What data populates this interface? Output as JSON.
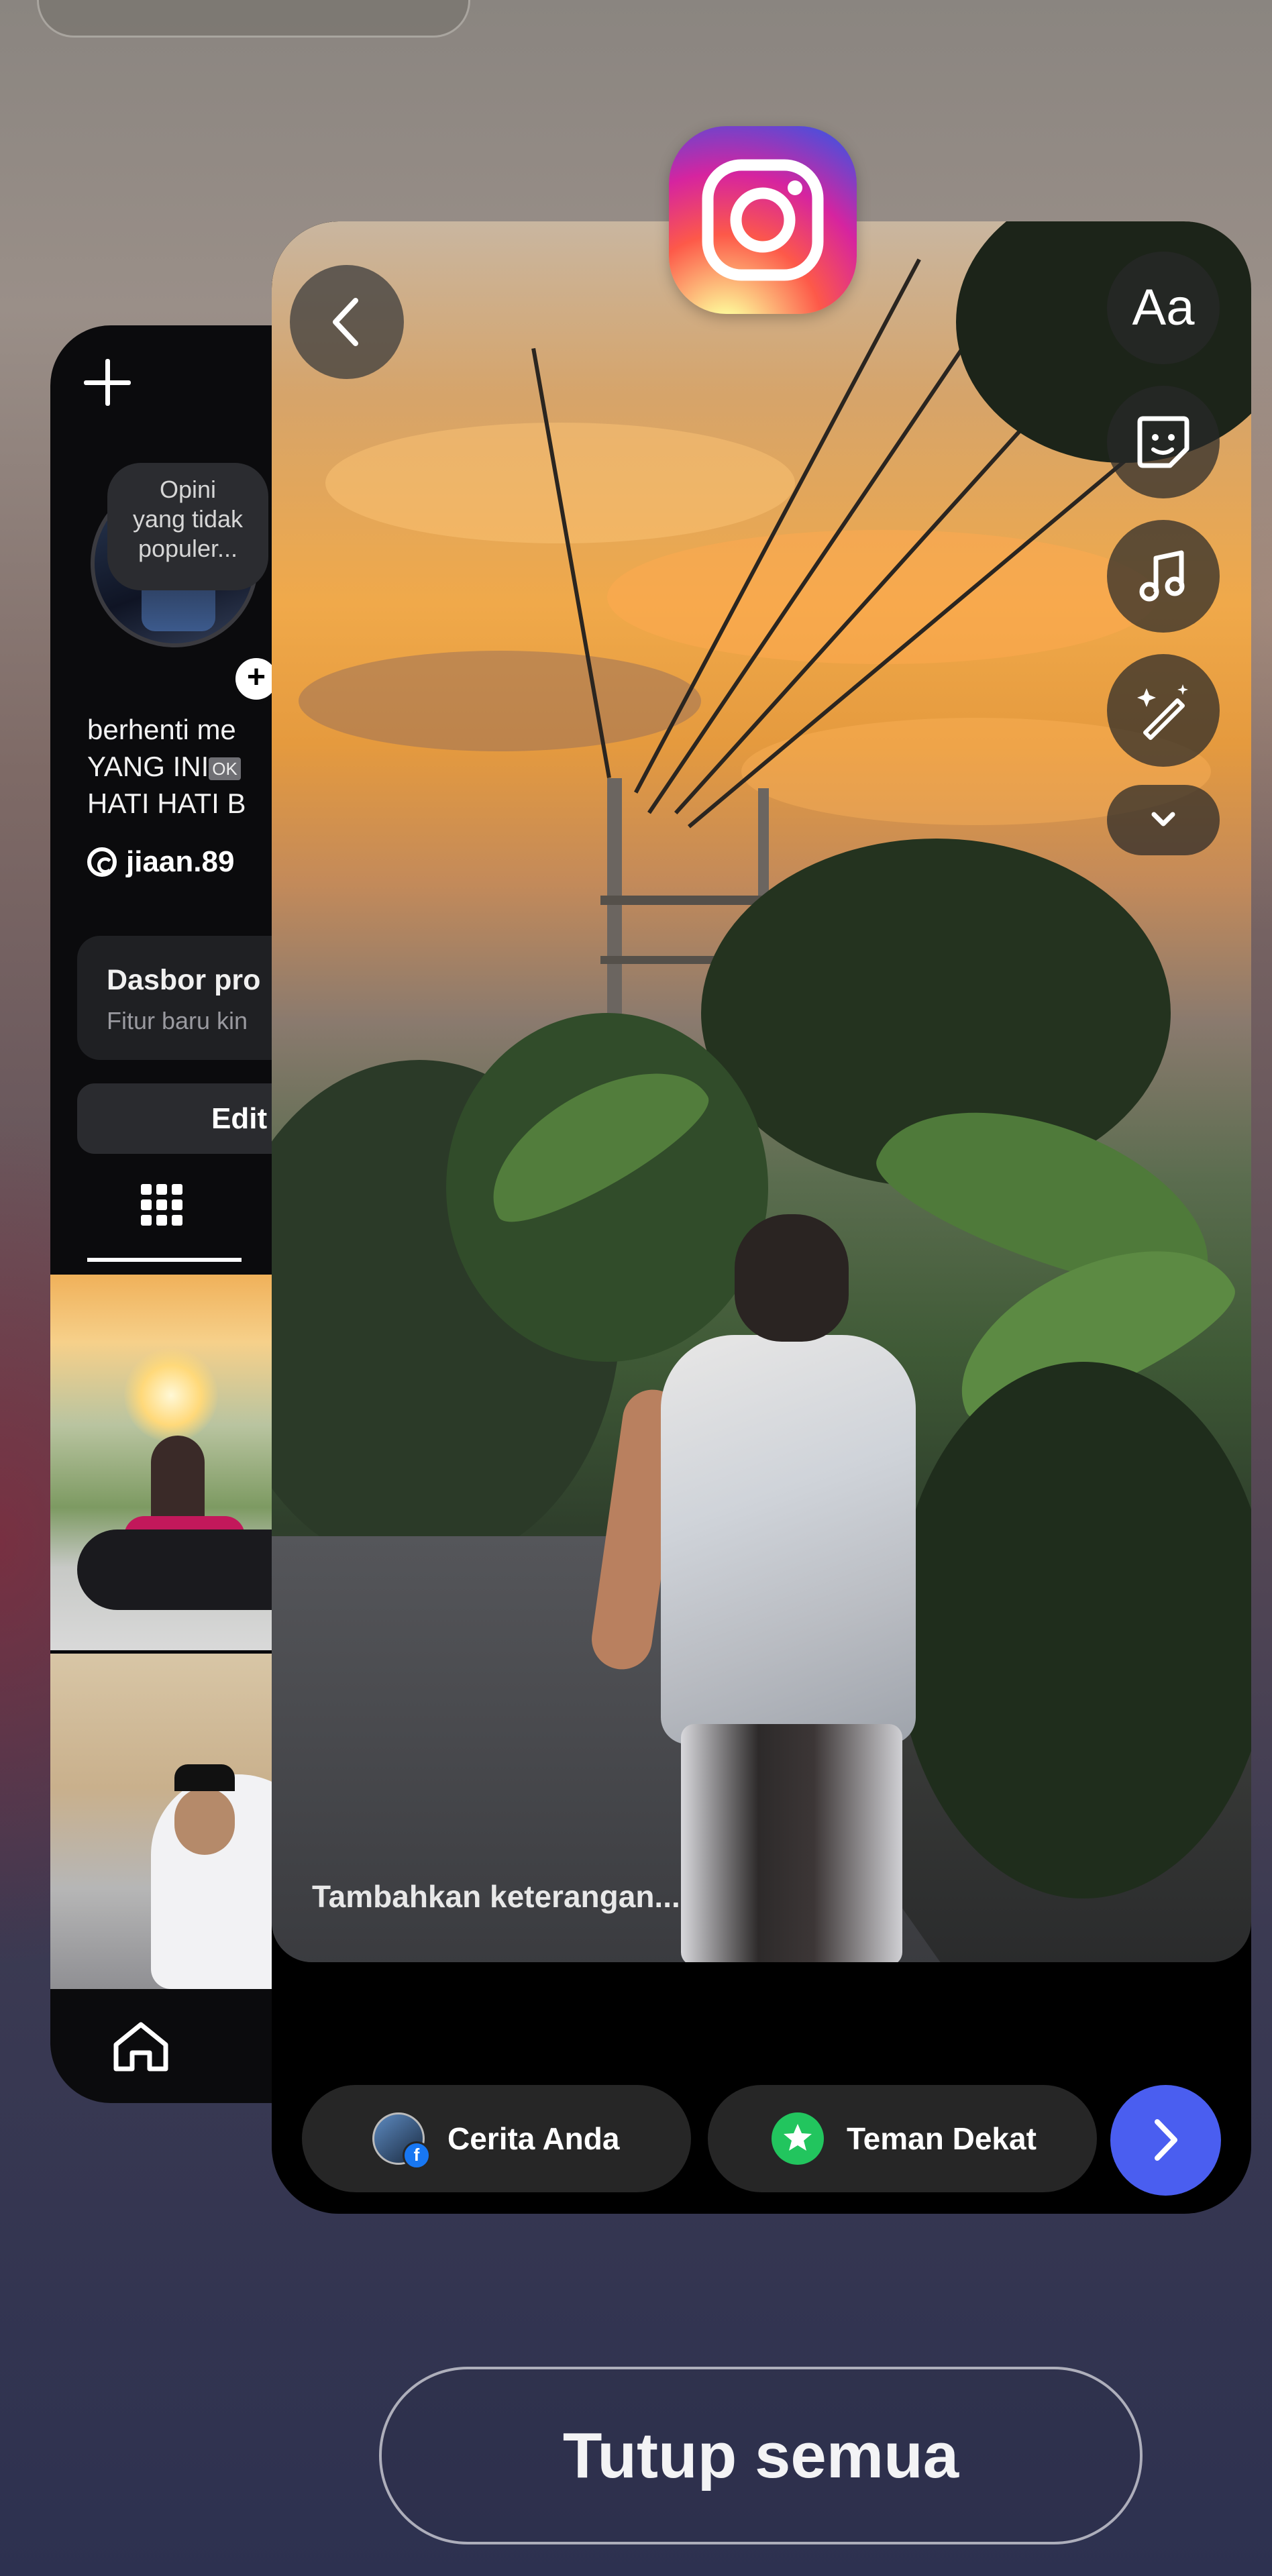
{
  "left_card": {
    "note": "Opini\nyang tidak\npopuler...",
    "bio_line1": "berhenti me",
    "bio_line2": "YANG INI",
    "bio_ok": "OK",
    "bio_line3": "HATI HATI B",
    "handle": "jiaan.89",
    "dashboard_title": "Dasbor pro",
    "dashboard_sub": "Fitur baru kin",
    "edit_label": "Edit",
    "icons": [
      "plus-icon",
      "add-story-icon",
      "threads-icon",
      "grid-icon",
      "home-icon"
    ]
  },
  "story_editor": {
    "caption_placeholder": "Tambahkan keterangan...",
    "tools": {
      "text_label": "Aa",
      "icons": [
        "back-arrow-icon",
        "sticker-icon",
        "music-icon",
        "effects-wand-icon",
        "chevron-down-icon"
      ]
    },
    "share": {
      "your_story": "Cerita Anda",
      "close_friends": "Teman Dekat",
      "next_icon": "chevron-right-icon"
    }
  },
  "app_icon": "instagram-icon",
  "close_all_label": "Tutup semua",
  "colors": {
    "next_button": "#4a5ef0",
    "close_friends_green": "#22c55e",
    "facebook_blue": "#1877f2"
  }
}
